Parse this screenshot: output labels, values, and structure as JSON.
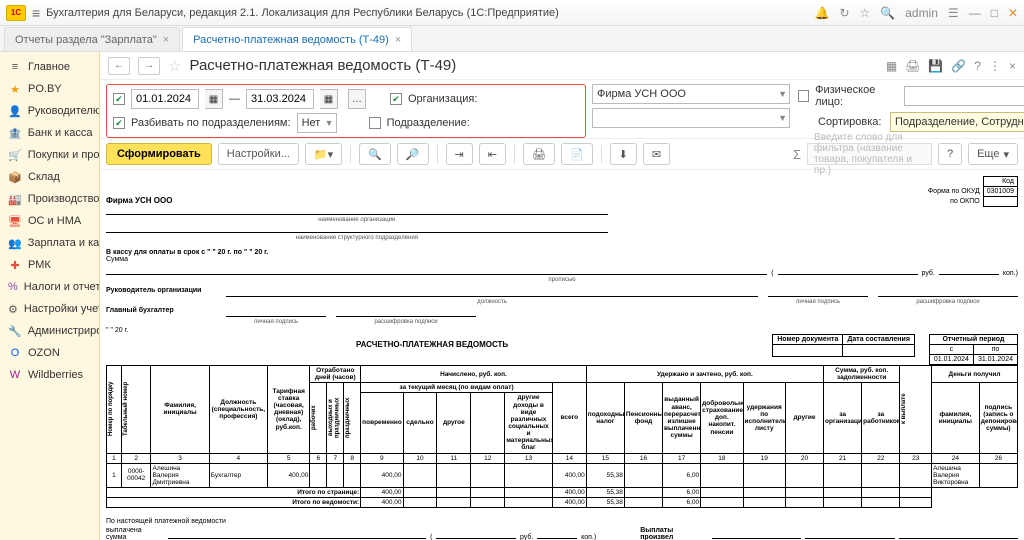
{
  "app": {
    "title": "Бухгалтерия для Беларуси, редакция 2.1. Локализация для Республики Беларусь  (1С:Предприятие)",
    "user": "admin"
  },
  "tabs": [
    {
      "label": "Отчеты раздела \"Зарплата\"",
      "active": false
    },
    {
      "label": "Расчетно-платежная ведомость (Т-49)",
      "active": true
    }
  ],
  "sidebar": [
    {
      "icon": "≡",
      "label": "Главное",
      "color": "#555"
    },
    {
      "icon": "★",
      "label": "PO.BY",
      "color": "#f39c12"
    },
    {
      "icon": "👤",
      "label": "Руководителю",
      "color": "#c06"
    },
    {
      "icon": "🏦",
      "label": "Банк и касса",
      "color": "#1a8f3a"
    },
    {
      "icon": "🛒",
      "label": "Покупки и продажи",
      "color": "#1a6fb5"
    },
    {
      "icon": "📦",
      "label": "Склад",
      "color": "#c06"
    },
    {
      "icon": "🏭",
      "label": "Производство",
      "color": "#555"
    },
    {
      "icon": "🖥",
      "label": "ОС и НМА",
      "color": "#e74c3c"
    },
    {
      "icon": "👥",
      "label": "Зарплата и кадры",
      "color": "#1a6fb5"
    },
    {
      "icon": "✚",
      "label": "РМК",
      "color": "#e74c3c"
    },
    {
      "icon": "%",
      "label": "Налоги и отчетность",
      "color": "#8e44ad"
    },
    {
      "icon": "⚙",
      "label": "Настройки учета",
      "color": "#555"
    },
    {
      "icon": "🔧",
      "label": "Администрирование",
      "color": "#555"
    },
    {
      "icon": "O",
      "label": "OZON",
      "color": "#005bff"
    },
    {
      "icon": "W",
      "label": "Wildberries",
      "color": "#a3208f"
    }
  ],
  "page": {
    "title": "Расчетно-платежная ведомость (Т-49)",
    "date_from": "01.01.2024",
    "date_to": "31.03.2024",
    "org_label": "Организация:",
    "org_value": "Фирма УСН ООО",
    "split_label": "Разбивать по подразделениям:",
    "split_value": "Нет",
    "dept_label": "Подразделение:",
    "fiz_label": "Физическое лицо:",
    "sort_label": "Сортировка:",
    "sort_value": "Подразделение, Сотрудник"
  },
  "toolbar": {
    "form": "Сформировать",
    "settings": "Настройки...",
    "more": "Еще",
    "search_placeholder": "Введите слово для фильтра (название товара, покупателя и пр.)"
  },
  "report": {
    "org": "Фирма УСН ООО",
    "okud": "0301009",
    "cash_line": "В кассу для оплаты в срок с \"        \"                    20      г.  по  \"        \"                    20      г.",
    "sum_label": "Сумма",
    "rub": "руб.",
    "kop": "коп.)",
    "head_org": "Руководитель организации",
    "chief_acc": "Главный бухгалтер",
    "date_blank": "\"        \"                    20      г.",
    "doc_title": "РАСЧЕТНО-ПЛАТЕЖНАЯ ВЕДОМОСТЬ",
    "doc_num_h": "Номер документа",
    "doc_date_h": "Дата составления",
    "period_h": "Отчетный период",
    "period_from": "01.01.2024",
    "period_to": "31.01.2024",
    "headers": {
      "worked": "Отработано дней (часов)",
      "accrued": "Начислено, руб. коп.",
      "accrued_sub": "за текущий месяц (по видам оплат)",
      "withheld": "Удержано и зачтено, руб. коп.",
      "sum_rk": "Сумма, руб. коп. задолженности",
      "received": "Деньги получил",
      "npp": "Номер по порядку",
      "tab": "Табельный номер",
      "fio": "Фамилия, инициалы",
      "pos": "Должность (специальность, профессия)",
      "rate": "Тарифная ставка (часовая, дневная) (оклад), руб.коп.",
      "work": "рабочих",
      "hol": "выходных и праздничных",
      "pov": "повременно",
      "sdel": "сдельно",
      "other": "другое",
      "other_inc": "другие доходы в виде различных социальных и материальных благ",
      "total": "всего",
      "tax": "подоходный налог",
      "pens": "Пенсионный фонд",
      "pens_ret": "выданный аванс, перерасчет, излишне выплаченные суммы",
      "vol": "добровольное страхование доп. накопит. пенсии",
      "exec": "удержания по исполнительному листу",
      "oth2": "другие",
      "by_org": "за организацией",
      "by_emp": "за работником",
      "pay": "к выплате",
      "fio2": "фамилия, инициалы",
      "sign": "подпись (запись о депонировании суммы)"
    },
    "row": {
      "n": "1",
      "tab": "0000-00042",
      "fio": "Алешина Валерия Дмитриевна",
      "pos": "Бухгалтер",
      "rate": "400,00",
      "c9": "400,00",
      "c14": "400,00",
      "c15": "55,38",
      "c17": "6,00",
      "fio2": "Алешина Валерия Викторовна"
    },
    "totals_page": "Итого по странице:",
    "totals_doc": "Итого по ведомости:",
    "t9": "400,00",
    "t14": "400,00",
    "t15": "55,38",
    "t17": "6,00",
    "foot1": "По настоящей платежной ведомости",
    "foot2": "выплачена сумма",
    "foot_rub": "руб.",
    "foot_kop": "коп.)",
    "foot_paid": "Выплаты произвел"
  }
}
